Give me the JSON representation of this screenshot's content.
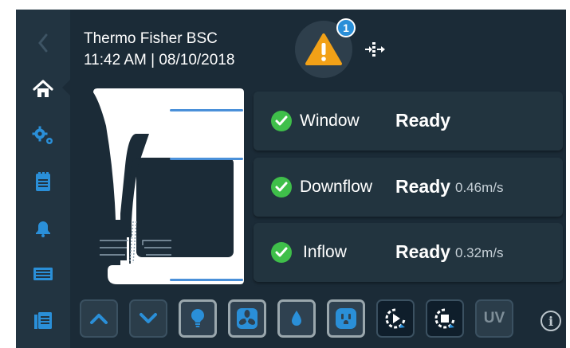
{
  "header": {
    "device_name": "Thermo Fisher BSC",
    "time_date": "11:42  AM | 08/10/2018",
    "alert_count": "1"
  },
  "sidebar": {
    "items": [
      {
        "name": "back",
        "icon": "chevron-left-icon"
      },
      {
        "name": "home",
        "icon": "home-icon",
        "active": true
      },
      {
        "name": "settings",
        "icon": "gears-icon"
      },
      {
        "name": "log",
        "icon": "clipboard-icon"
      },
      {
        "name": "alarms",
        "icon": "bell-icon"
      },
      {
        "name": "display",
        "icon": "monitor-icon"
      },
      {
        "name": "reports",
        "icon": "files-icon"
      }
    ]
  },
  "status": [
    {
      "label": "Window",
      "state": "Ready",
      "value": ""
    },
    {
      "label": "Downflow",
      "state": "Ready",
      "value": "0.46m/s"
    },
    {
      "label": "Inflow",
      "state": "Ready",
      "value": "0.32m/s"
    }
  ],
  "toolbar": {
    "buttons": [
      {
        "name": "up",
        "icon": "chevron-up-icon"
      },
      {
        "name": "down",
        "icon": "chevron-down-icon"
      },
      {
        "name": "light",
        "icon": "lightbulb-icon"
      },
      {
        "name": "fan",
        "icon": "fan-icon"
      },
      {
        "name": "water",
        "icon": "droplet-icon"
      },
      {
        "name": "outlet",
        "icon": "outlet-icon"
      },
      {
        "name": "start-cycle",
        "icon": "play-cycle-icon"
      },
      {
        "name": "stop-cycle",
        "icon": "stop-cycle-icon"
      },
      {
        "name": "uv",
        "icon": "uv-icon"
      }
    ],
    "uv_label": "UV",
    "info_label": "i"
  },
  "colors": {
    "background": "#1b2b37",
    "sidebar": "#223441",
    "accent_blue": "#2a8fd8",
    "ready_green": "#3fbf4a",
    "warning_orange": "#f2a117"
  }
}
